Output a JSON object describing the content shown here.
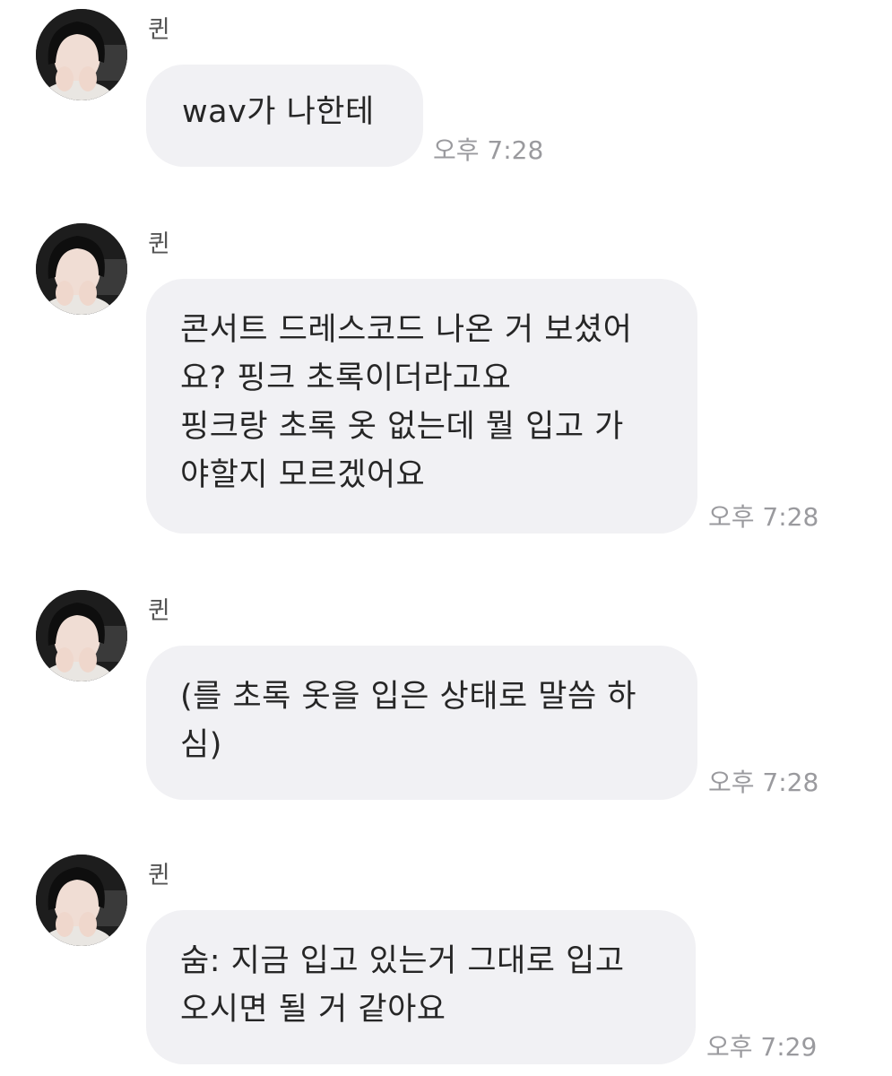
{
  "messages": [
    {
      "sender": "퀸",
      "lines": [
        "wav가 나한테"
      ],
      "time": "오후 7:28",
      "avatar_icon": "profile-photo-icon"
    },
    {
      "sender": "퀸",
      "lines": [
        "콘서트 드레스코드 나온 거 보셨어",
        "요? 핑크 초록이더라고요",
        "핑크랑 초록 옷 없는데 뭘 입고 가",
        "야할지 모르겠어요"
      ],
      "time": "오후 7:28",
      "avatar_icon": "profile-photo-icon"
    },
    {
      "sender": "퀸",
      "lines": [
        "(를 초록 옷을 입은 상태로 말씀 하",
        "심)"
      ],
      "time": "오후 7:28",
      "avatar_icon": "profile-photo-icon"
    },
    {
      "sender": "퀸",
      "lines": [
        "숨: 지금 입고 있는거 그대로 입고",
        "오시면 될 거 같아요"
      ],
      "time": "오후 7:29",
      "avatar_icon": "profile-photo-icon"
    }
  ],
  "colors": {
    "bubble": "#f1f1f4",
    "timestamp": "#9a9a9e",
    "background": "#ffffff"
  }
}
